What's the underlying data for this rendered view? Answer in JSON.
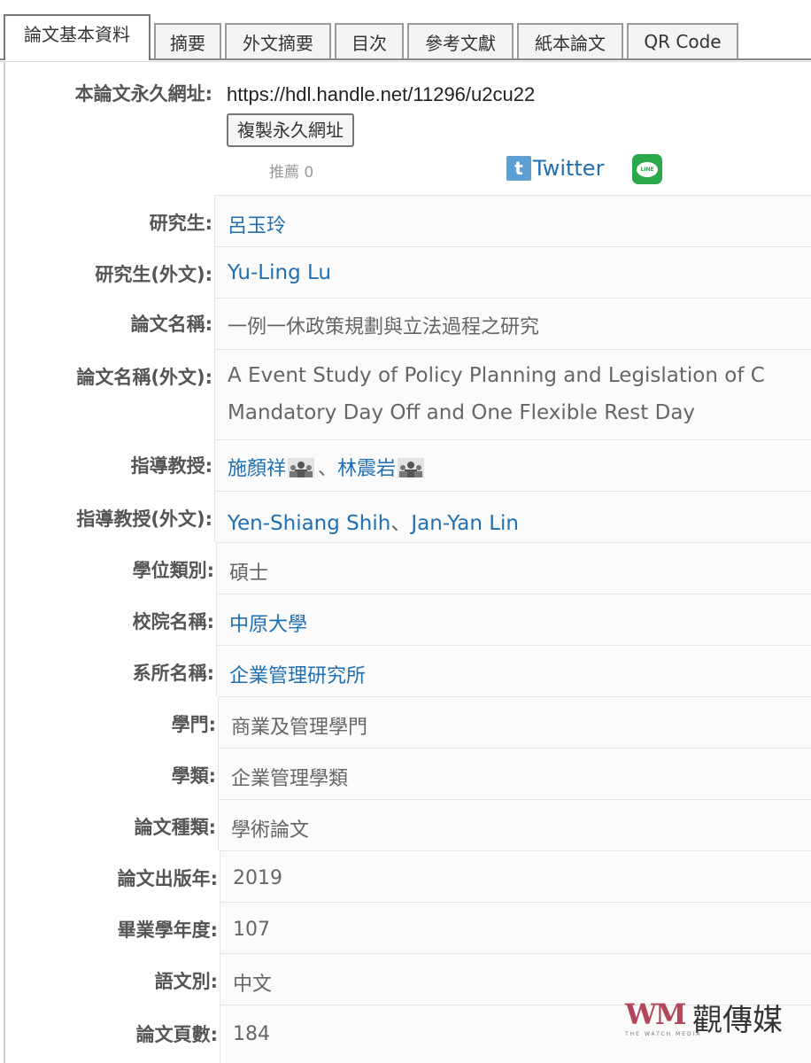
{
  "tabs": [
    {
      "label": "論文基本資料",
      "active": true
    },
    {
      "label": "摘要"
    },
    {
      "label": "外文摘要"
    },
    {
      "label": "目次"
    },
    {
      "label": "參考文獻"
    },
    {
      "label": "紙本論文"
    },
    {
      "label": "QR Code"
    }
  ],
  "permalink": {
    "label": "本論文永久網址:",
    "url": "https://hdl.handle.net/11296/u2cu22",
    "copy_button": "複製永久網址",
    "recommend": "推薦 0",
    "twitter": "Twitter",
    "line_icon_text": "LINE"
  },
  "fields": {
    "student": {
      "label": "研究生:",
      "value": "呂玉玲"
    },
    "student_en": {
      "label": "研究生(外文):",
      "value": "Yu-Ling Lu"
    },
    "title": {
      "label": "論文名稱:",
      "value": "一例一休政策規劃與立法過程之研究"
    },
    "title_en": {
      "label": "論文名稱(外文):",
      "line1": "A Event Study of Policy Planning and Legislation of C",
      "line2": "Mandatory Day Off and One Flexible Rest Day"
    },
    "advisor": {
      "label": "指導教授:",
      "name1": "施顏祥",
      "sep": "、",
      "name2": "林震岩"
    },
    "advisor_en": {
      "label": "指導教授(外文):",
      "name1": "Yen-Shiang Shih",
      "sep": "、",
      "name2": "Jan-Yan Lin"
    },
    "degree": {
      "label": "學位類別:",
      "value": "碩士"
    },
    "school": {
      "label": "校院名稱:",
      "value": "中原大學"
    },
    "department": {
      "label": "系所名稱:",
      "value": "企業管理研究所"
    },
    "discipline": {
      "label": "學門:",
      "value": "商業及管理學門"
    },
    "category": {
      "label": "學類:",
      "value": "企業管理學類"
    },
    "thesis_type": {
      "label": "論文種類:",
      "value": "學術論文"
    },
    "pub_year": {
      "label": "論文出版年:",
      "value": "2019"
    },
    "grad_year": {
      "label": "畢業學年度:",
      "value": "107"
    },
    "language": {
      "label": "語文別:",
      "value": "中文"
    },
    "pages": {
      "label": "論文頁數:",
      "value": "184"
    }
  },
  "watermark": {
    "logo": "WM",
    "chinese": "觀傳媒",
    "sub": "THE WATCH MEDIA"
  },
  "colors": {
    "link": "#1f6fb2",
    "label": "#555555",
    "value": "#666666",
    "line_green": "#2aa84a",
    "watermark": "#b2475b"
  }
}
